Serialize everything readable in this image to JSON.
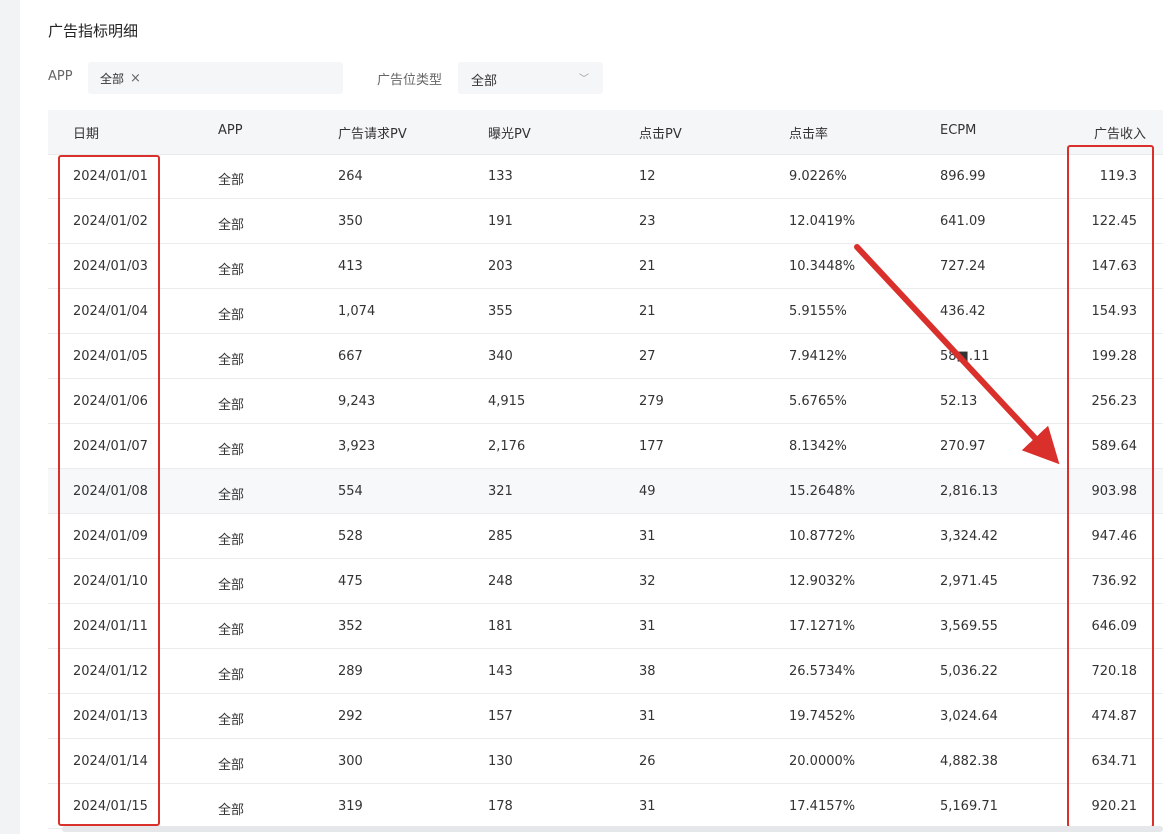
{
  "title": "广告指标明细",
  "filters": {
    "app_label": "APP",
    "app_tag": "全部",
    "app_tag_close": "×",
    "type_label": "广告位类型",
    "type_value": "全部",
    "type_chevron": "﹀"
  },
  "columns": [
    "日期",
    "APP",
    "广告请求PV",
    "曝光PV",
    "点击PV",
    "点击率",
    "ECPM",
    "广告收入"
  ],
  "rows": [
    [
      "2024/01/01",
      "全部",
      "264",
      "133",
      "12",
      "9.0226%",
      "896.99",
      "119.3"
    ],
    [
      "2024/01/02",
      "全部",
      "350",
      "191",
      "23",
      "12.0419%",
      "641.09",
      "122.45"
    ],
    [
      "2024/01/03",
      "全部",
      "413",
      "203",
      "21",
      "10.3448%",
      "727.24",
      "147.63"
    ],
    [
      "2024/01/04",
      "全部",
      "1,074",
      "355",
      "21",
      "5.9155%",
      "436.42",
      "154.93"
    ],
    [
      "2024/01/05",
      "全部",
      "667",
      "340",
      "27",
      "7.9412%",
      "58■.11",
      "199.28"
    ],
    [
      "2024/01/06",
      "全部",
      "9,243",
      "4,915",
      "279",
      "5.6765%",
      "52.13",
      "256.23"
    ],
    [
      "2024/01/07",
      "全部",
      "3,923",
      "2,176",
      "177",
      "8.1342%",
      "270.97",
      "589.64"
    ],
    [
      "2024/01/08",
      "全部",
      "554",
      "321",
      "49",
      "15.2648%",
      "2,816.13",
      "903.98"
    ],
    [
      "2024/01/09",
      "全部",
      "528",
      "285",
      "31",
      "10.8772%",
      "3,324.42",
      "947.46"
    ],
    [
      "2024/01/10",
      "全部",
      "475",
      "248",
      "32",
      "12.9032%",
      "2,971.45",
      "736.92"
    ],
    [
      "2024/01/11",
      "全部",
      "352",
      "181",
      "31",
      "17.1271%",
      "3,569.55",
      "646.09"
    ],
    [
      "2024/01/12",
      "全部",
      "289",
      "143",
      "38",
      "26.5734%",
      "5,036.22",
      "720.18"
    ],
    [
      "2024/01/13",
      "全部",
      "292",
      "157",
      "31",
      "19.7452%",
      "3,024.64",
      "474.87"
    ],
    [
      "2024/01/14",
      "全部",
      "300",
      "130",
      "26",
      "20.0000%",
      "4,882.38",
      "634.71"
    ],
    [
      "2024/01/15",
      "全部",
      "319",
      "178",
      "31",
      "17.4157%",
      "5,169.71",
      "920.21"
    ]
  ],
  "highlight_row": 7,
  "annotation_color": "#d9302c"
}
